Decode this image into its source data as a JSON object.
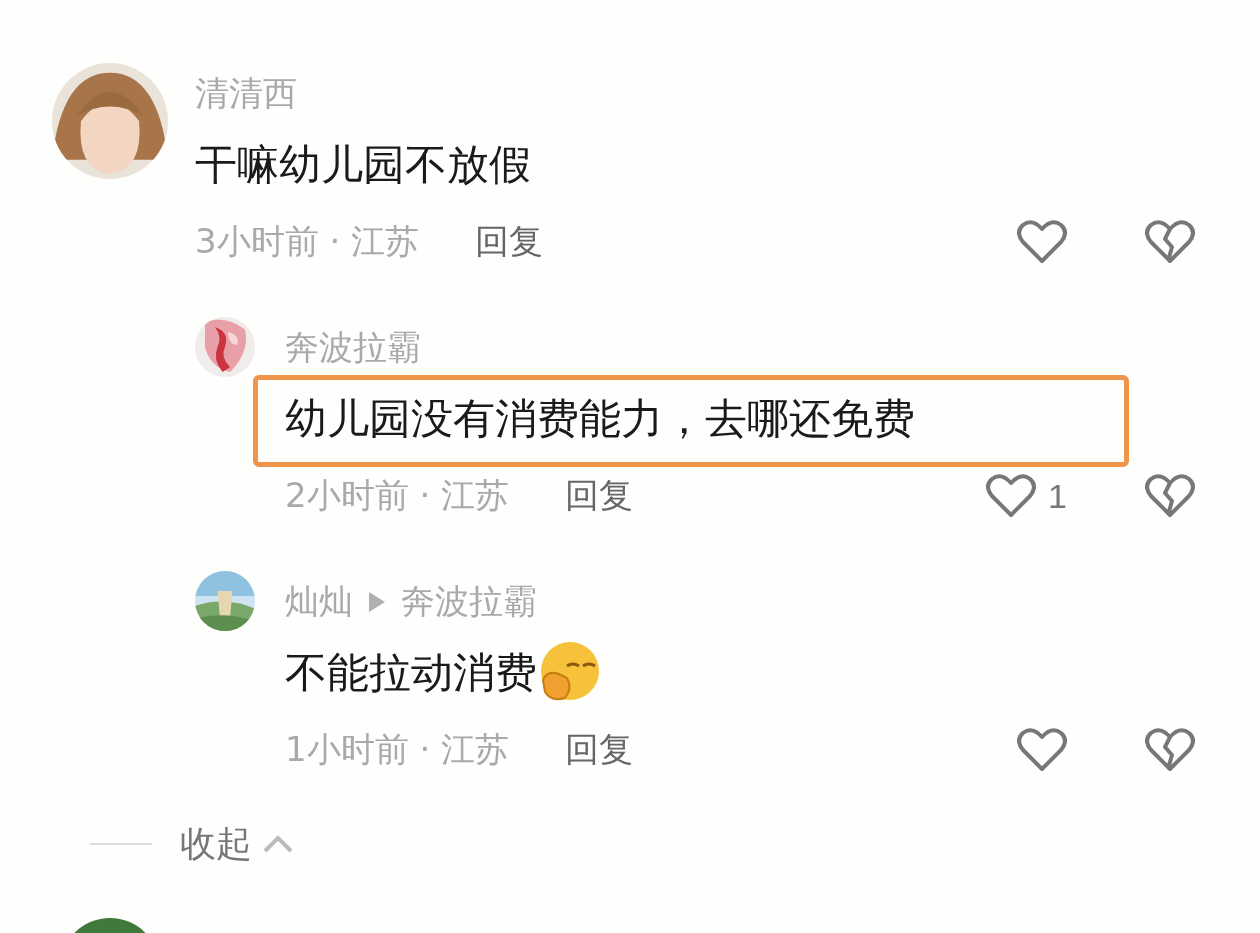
{
  "comments": [
    {
      "author": "清清西",
      "text": "干嘛幼儿园不放假",
      "meta": "3小时前 · 江苏",
      "reply_label": "回复",
      "replies": [
        {
          "author": "奔波拉霸",
          "text": "幼儿园没有消费能力，去哪还免费",
          "highlighted": true,
          "meta": "2小时前 · 江苏",
          "reply_label": "回复",
          "like_count": "1"
        },
        {
          "author": "灿灿",
          "reply_to": "奔波拉霸",
          "text": "不能拉动消费",
          "emoji": true,
          "highlighted": false,
          "meta": "1小时前 · 江苏",
          "reply_label": "回复"
        }
      ],
      "collapse_label": "收起"
    }
  ]
}
